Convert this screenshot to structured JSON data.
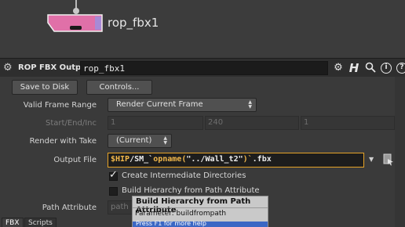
{
  "node": {
    "name": "rop_fbx1",
    "color": "#e070a8",
    "flag_color": "#a78ad6"
  },
  "header": {
    "gear_icon": "gear-icon",
    "node_type": "ROP FBX Output",
    "node_name_value": "rop_fbx1",
    "icons": [
      "gear-icon",
      "houdini-h-icon",
      "search-icon",
      "info-icon",
      "help-icon"
    ],
    "h_glyph": "H",
    "info_glyph": "i",
    "help_glyph": "?"
  },
  "buttons": {
    "save_to_disk": "Save to Disk",
    "controls": "Controls..."
  },
  "params": {
    "valid_frame_range": {
      "label": "Valid Frame Range",
      "value": "Render Current Frame"
    },
    "start_end_inc": {
      "label": "Start/End/Inc",
      "values": [
        "1",
        "240",
        "1"
      ]
    },
    "render_with_take": {
      "label": "Render with Take",
      "value": "(Current)"
    },
    "output_file": {
      "label": "Output File",
      "value_parts": [
        "$HIP",
        "/SM_`",
        "opname(",
        "\"../Wall_t2\"",
        ")`",
        ".fbx"
      ]
    },
    "create_intermediate_dirs": {
      "label": "Create Intermediate Directories",
      "checked": true
    },
    "build_hierarchy": {
      "label": "Build Hierarchy from Path Attribute",
      "checked": false
    },
    "path_attribute": {
      "label": "Path Attribute",
      "value": "path"
    }
  },
  "tooltip": {
    "title": "Build Hierarchy from Path Attribute",
    "parameter": "Parameter: buildfrompath",
    "footer": "Press F1 for more help"
  },
  "tabs": [
    "FBX",
    "Scripts"
  ],
  "colors": {
    "accent_border": "#e6a327",
    "var_highlight": "#f2b84b"
  }
}
